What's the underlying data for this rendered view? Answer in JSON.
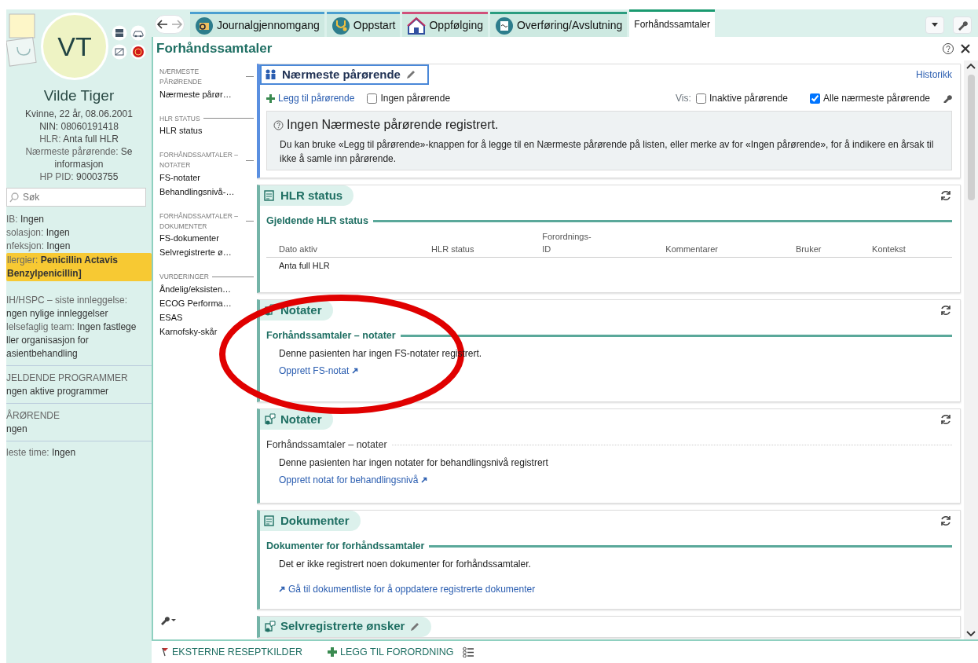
{
  "patient": {
    "initials": "VT",
    "name": "Vilde Tiger",
    "details": [
      "Kvinne, 22 år, 08.06.2001",
      "NIN: 08060191418"
    ],
    "facts_top": [
      {
        "label": "HLR:",
        "value": "Anta full HLR"
      },
      {
        "label": "Nærmeste pårørende:",
        "value": "Se informasjon"
      },
      {
        "label": "HP PID:",
        "value": "90003755"
      }
    ],
    "search": {
      "placeholder": "Søk"
    },
    "facts": [
      {
        "label": "IB:",
        "value": "Ingen",
        "alert": false
      },
      {
        "label": "solasjon:",
        "value": "Ingen",
        "alert": false
      },
      {
        "label": "nfeksjon:",
        "value": "Ingen",
        "alert": false
      },
      {
        "label": "llergier:",
        "value": "Penicillin Actavis\nBenzylpenicillin]",
        "alert": true
      },
      {
        "label": "IH/HSPC – siste innleggelse:",
        "value": "ngen nylige innleggelser",
        "alert": false
      },
      {
        "label": "lelsefaglig team:",
        "value": "Ingen fastlege\nller organisasjon for\nasientbehandling",
        "alert": false
      }
    ],
    "sections": [
      {
        "heading": "JELDENDE PROGRAMMER",
        "value": "ngen aktive programmer"
      },
      {
        "heading": "ÅRØRENDE",
        "value": "ngen"
      },
      {
        "label": "leste time:",
        "value": "Ingen"
      }
    ]
  },
  "tabs": [
    {
      "label": "Journalgjennomgang",
      "selected": false,
      "color": "#4a9fd0"
    },
    {
      "label": "Oppstart",
      "selected": false,
      "color": "#4a9fd0"
    },
    {
      "label": "Oppfølging",
      "selected": false,
      "color": "#d0507a"
    },
    {
      "label": "Overføring/Avslutning",
      "selected": false,
      "color": "#2a9d7f"
    },
    {
      "label": "Forhåndssamtaler",
      "selected": true,
      "color": "#1a9a70"
    }
  ],
  "page_title": "Forhåndssamtaler",
  "nav": [
    {
      "heading": "NÆRMESTE PÅRØRENDE",
      "items": [
        "Nærmeste pårør…"
      ]
    },
    {
      "heading": "HLR STATUS",
      "items": [
        "HLR status"
      ]
    },
    {
      "heading": "FORHÅNDSSAMTALER – NOTATER",
      "items": [
        "FS-notater",
        "Behandlingsnivå-…"
      ]
    },
    {
      "heading": "FORHÅNDSSAMTALER – DOKUMENTER",
      "items": [
        "FS-dokumenter",
        "Selvregistrerte ø…"
      ]
    },
    {
      "heading": "VURDERINGER",
      "items": [
        "Åndelig/eksisten…",
        "ECOG Performa…",
        "ESAS",
        "Karnofsky-skår"
      ]
    }
  ],
  "relatives": {
    "title": "Nærmeste pårørende",
    "selected": true,
    "history": "Historikk",
    "add": "Legg til pårørende",
    "none": {
      "label": "Ingen pårørende",
      "checked": false
    },
    "show_label": "Vis:",
    "filters": [
      {
        "label": "Inaktive pårørende",
        "checked": false
      },
      {
        "label": "Alle nærmeste pårørende",
        "checked": true
      }
    ],
    "info_title": "Ingen Nærmeste pårørende registrert.",
    "info_text": "Du kan bruke «Legg til pårørende»-knappen for å legge til en Nærmeste pårørende på listen, eller merke av for «Ingen pårørende», for å indikere en årsak til ikke å samle inn pårørende."
  },
  "hlr": {
    "title": "HLR status",
    "section": "Gjeldende HLR status",
    "columns": [
      "Dato aktiv",
      "HLR status",
      "Forordnings-\nID",
      "Kommentarer",
      "Bruker",
      "Kontekst"
    ],
    "rows": [
      {
        "cells": [
          "Anta full HLR"
        ]
      }
    ]
  },
  "cards": [
    {
      "kind": "notes",
      "title": "Notater",
      "section": "Forhåndssamtaler – notater",
      "strong": true,
      "message": "Denne pasienten har ingen FS-notater registrert.",
      "link": "Opprett FS-notat"
    },
    {
      "kind": "notes",
      "title": "Notater",
      "section": "Forhåndssamtaler – notater",
      "strong": false,
      "message": "Denne pasienten har ingen notater for behandlingsnivå registrert",
      "link": "Opprett notat for behandlingsnivå"
    },
    {
      "kind": "documents",
      "title": "Dokumenter",
      "section": "Dokumenter for forhåndssamtaler",
      "strong": true,
      "message": "Det er ikke registrert noen dokumenter for forhåndssamtaler.",
      "link": "Gå til dokumentliste for å oppdatere registrerte dokumenter"
    }
  ],
  "last_card": {
    "title": "Selvregistrerte ønsker"
  },
  "bottom_bar": {
    "buttons": [
      {
        "kind": "flag",
        "label": "EKSTERNE RESEPTKILDER"
      },
      {
        "kind": "plus",
        "label": "LEGG TIL FORORDNING"
      }
    ]
  }
}
